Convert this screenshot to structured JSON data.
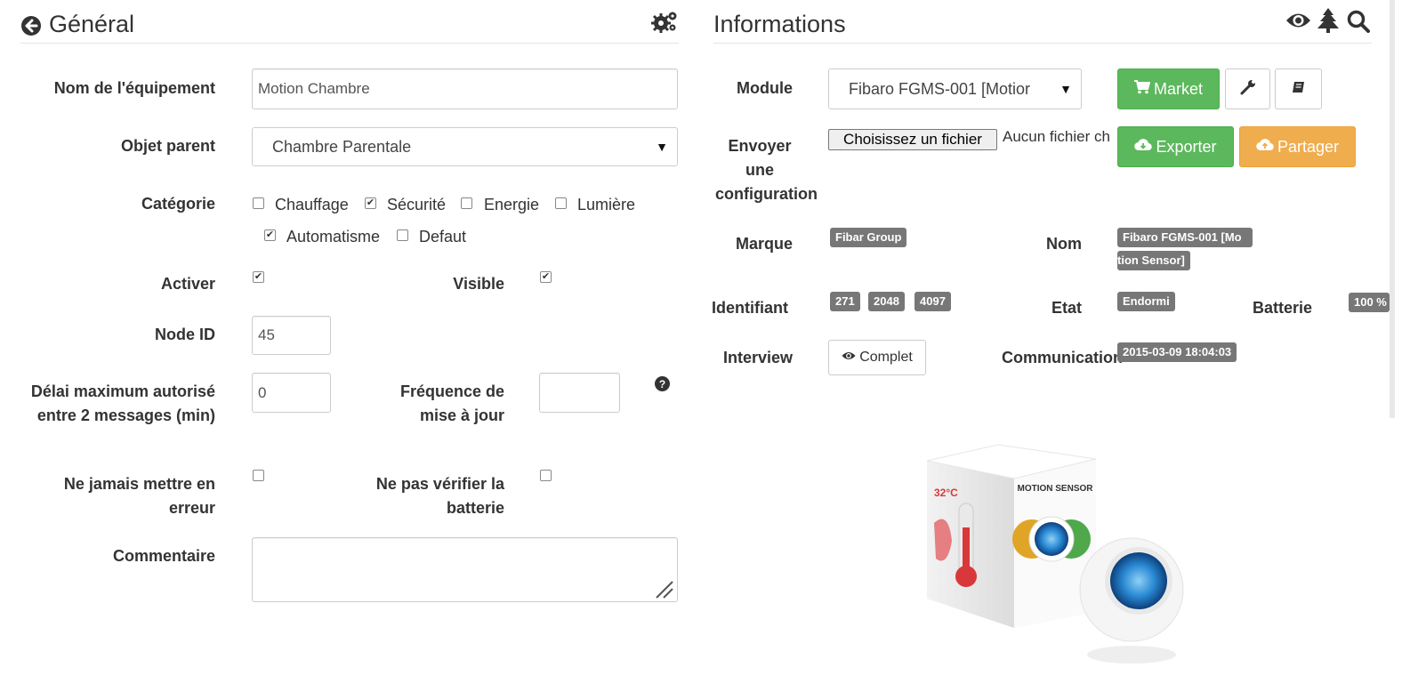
{
  "general": {
    "title": "Général",
    "fields": {
      "name_label": "Nom de l'équipement",
      "name_value": "Motion Chambre",
      "parent_label": "Objet parent",
      "parent_value": "Chambre Parentale",
      "category_label": "Catégorie",
      "categories": [
        {
          "label": "Chauffage",
          "checked": false
        },
        {
          "label": "Sécurité",
          "checked": true
        },
        {
          "label": "Energie",
          "checked": false
        },
        {
          "label": "Lumière",
          "checked": false
        },
        {
          "label": "Automatisme",
          "checked": true
        },
        {
          "label": "Defaut",
          "checked": false
        }
      ],
      "activate_label": "Activer",
      "visible_label": "Visible",
      "nodeid_label": "Node ID",
      "nodeid_value": "45",
      "delay_label_1": "Délai maximum autorisé",
      "delay_label_2": "entre 2 messages (min)",
      "delay_value": "0",
      "freq_label_1": "Fréquence de",
      "freq_label_2": "mise à jour",
      "freq_value": "",
      "never_error_label_1": "Ne jamais mettre en",
      "never_error_label_2": "erreur",
      "no_battery_label_1": "Ne pas vérifier la",
      "no_battery_label_2": "batterie",
      "comment_label": "Commentaire",
      "comment_value": ""
    }
  },
  "info": {
    "title": "Informations",
    "module_label": "Module",
    "module_value": "Fibaro FGMS-001 [Motior",
    "market_label": "Market",
    "send_config_label_1": "Envoyer",
    "send_config_label_2": "une",
    "send_config_label_3": "configuration",
    "file_button": "Choisissez un fichier",
    "file_status": "Aucun fichier ch",
    "export_label": "Exporter",
    "share_label": "Partager",
    "brand_label": "Marque",
    "brand_value": "Fibar Group",
    "name_label": "Nom",
    "name_value_1": "Fibaro FGMS-001 [Mo",
    "name_value_2": "tion Sensor]",
    "id_label": "Identifiant",
    "ids": [
      "271",
      "2048",
      "4097"
    ],
    "state_label": "Etat",
    "state_value": "Endormi",
    "battery_label": "Batterie",
    "battery_value": "100 %",
    "interview_label": "Interview",
    "interview_value": "Complet",
    "comm_label": "Communication",
    "comm_value": "2015-03-09 18:04:03",
    "product_box_text": "MOTION SENSOR",
    "product_temp": "32°C"
  },
  "colors": {
    "green": "#5cb85c",
    "orange": "#f0ad4e",
    "badge": "#777777"
  }
}
